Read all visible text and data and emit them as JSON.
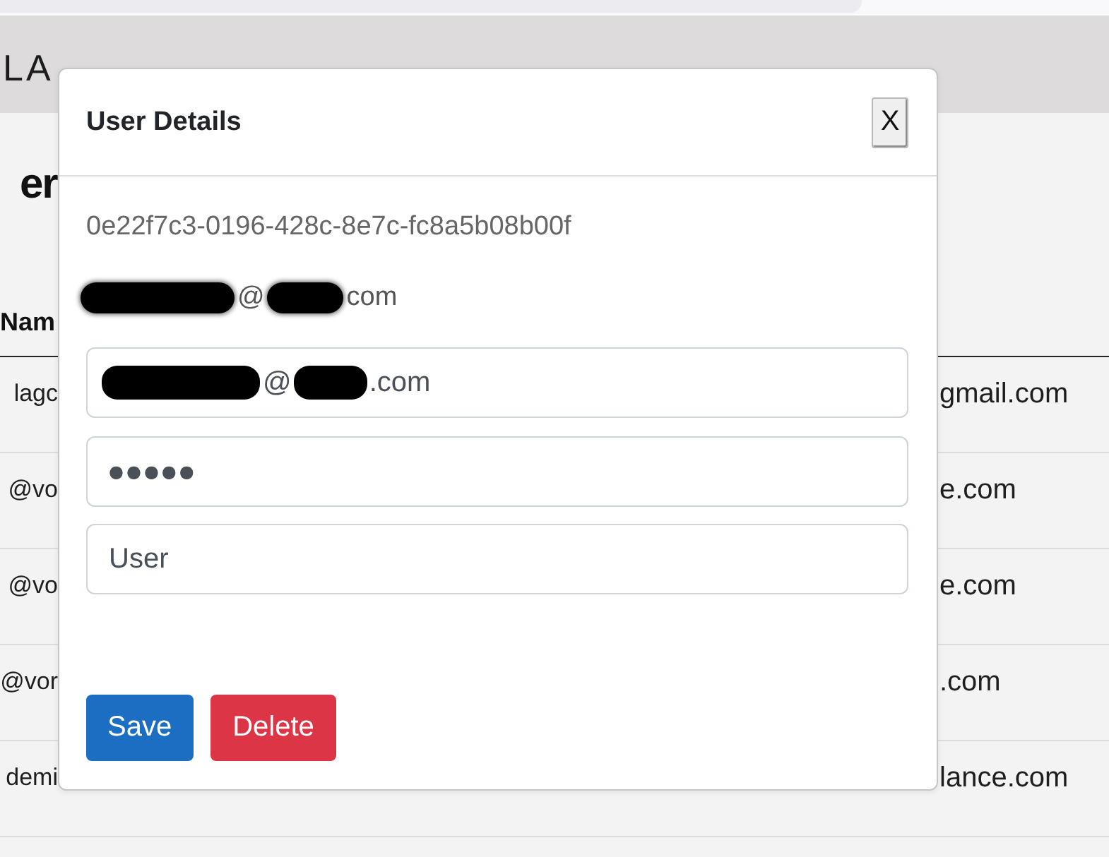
{
  "header": {
    "logo": "LA"
  },
  "page": {
    "heading": "er",
    "table": {
      "header": "Nam",
      "rows": [
        {
          "column_1": "lagc",
          "column_3": "gmail.com"
        },
        {
          "column_1": "@vo",
          "column_3": "e.com"
        },
        {
          "column_1": "@vo",
          "column_3": "e.com"
        },
        {
          "column_1": "@vor",
          "column_3": ".com"
        },
        {
          "column_1": "demi",
          "column_3": "lance.com"
        }
      ]
    }
  },
  "modal": {
    "title": "User Details",
    "close_label": "X",
    "user_id": "0e22f7c3-0196-428c-8e7c-fc8a5b08b00f",
    "email_line": [
      {
        "kind": "redacted"
      },
      {
        "kind": "text",
        "text": "@"
      },
      {
        "kind": "redacted"
      },
      {
        "kind": "text",
        "text": "com"
      }
    ],
    "fields": [
      {
        "kind": "email",
        "parts": [
          {
            "kind": "redacted"
          },
          {
            "kind": "text",
            "text": "@"
          },
          {
            "kind": "redacted"
          },
          {
            "kind": "text",
            "text": ".com"
          }
        ]
      },
      {
        "kind": "password",
        "value": "●●●●●"
      },
      {
        "kind": "text",
        "value": "User"
      }
    ],
    "buttons": [
      {
        "kind": "primary",
        "label": "Save"
      },
      {
        "kind": "danger",
        "label": "Delete"
      }
    ]
  }
}
